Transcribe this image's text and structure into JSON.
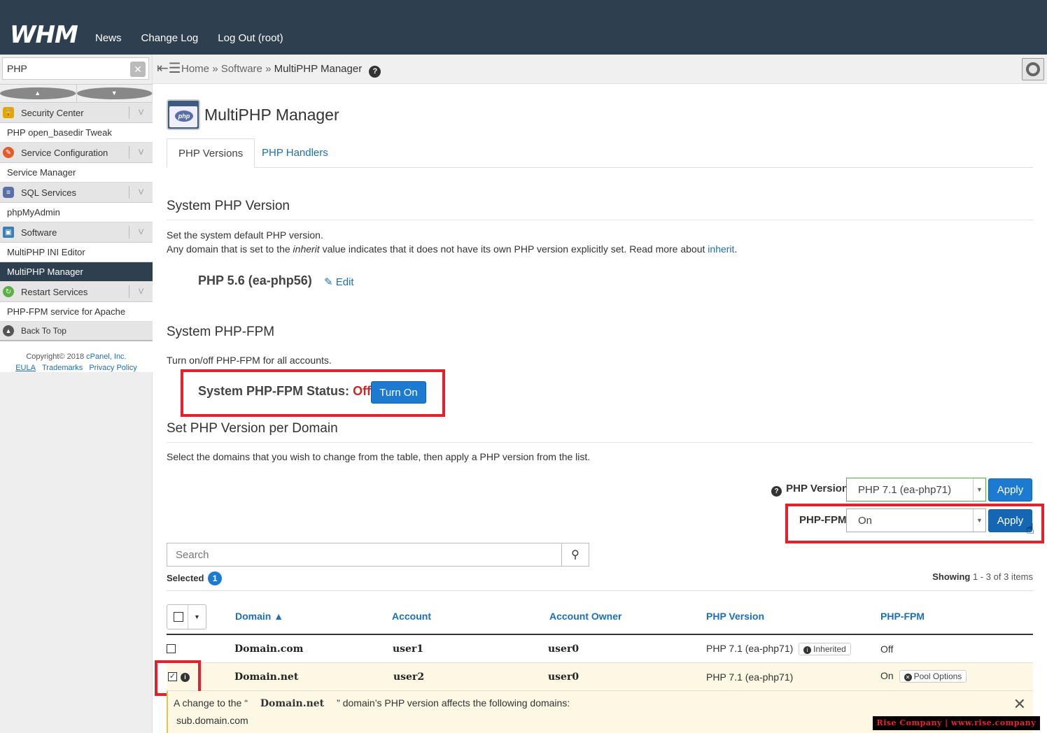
{
  "header": {
    "logo": "WHM",
    "nav": [
      "News",
      "Change Log",
      "Log Out (root)"
    ]
  },
  "sidebar": {
    "search_value": "PHP",
    "items": [
      {
        "type": "category",
        "label": "Security Center",
        "icon": "lock-icon",
        "color": "#e6a400"
      },
      {
        "type": "item",
        "label": "PHP open_basedir Tweak"
      },
      {
        "type": "category",
        "label": "Service Configuration",
        "icon": "wrench-icon",
        "color": "#e25c2a"
      },
      {
        "type": "item",
        "label": "Service Manager"
      },
      {
        "type": "category",
        "label": "SQL Services",
        "icon": "database-icon",
        "color": "#5a6fa8"
      },
      {
        "type": "item",
        "label": "phpMyAdmin"
      },
      {
        "type": "category",
        "label": "Software",
        "icon": "software-icon",
        "color": "#3b7fb5"
      },
      {
        "type": "item",
        "label": "MultiPHP INI Editor"
      },
      {
        "type": "item",
        "label": "MultiPHP Manager",
        "active": true
      },
      {
        "type": "category",
        "label": "Restart Services",
        "icon": "restart-icon",
        "color": "#5bb043"
      },
      {
        "type": "item",
        "label": "PHP-FPM service for Apache"
      }
    ],
    "back_to_top": "Back To Top",
    "copyright": "Copyright© 2018",
    "copyright_link": "cPanel, Inc.",
    "footer_links": [
      "EULA",
      "Trademarks",
      "Privacy Policy"
    ]
  },
  "breadcrumb": {
    "home": "Home",
    "section": "Software",
    "current": "MultiPHP Manager",
    "sep": "»"
  },
  "page": {
    "title": "MultiPHP Manager",
    "tabs": [
      "PHP Versions",
      "PHP Handlers"
    ],
    "system_php": {
      "heading": "System PHP Version",
      "line1": "Set the system default PHP version.",
      "line2_pre": "Any domain that is set to the",
      "line2_em": "inherit",
      "line2_post": "value indicates that it does not have its own PHP version explicitly set. Read more about",
      "line2_link": "inherit",
      "line2_end": ".",
      "current": "PHP 5.6 (ea-php56)",
      "edit": "Edit"
    },
    "fpm": {
      "heading": "System PHP-FPM",
      "desc": "Turn on/off PHP-FPM for all accounts.",
      "status_label": "System PHP-FPM Status:",
      "status_value": "Off",
      "button": "Turn On"
    },
    "per_domain": {
      "heading": "Set PHP Version per Domain",
      "desc": "Select the domains that you wish to change from the table, then apply a PHP version from the list.",
      "php_version_label": "PHP Version",
      "php_version_value": "PHP 7.1 (ea-php71)",
      "fpm_label": "PHP-FPM",
      "fpm_value": "On",
      "apply": "Apply",
      "search_placeholder": "Search",
      "selected_label": "Selected",
      "selected_count": "1",
      "showing_label": "Showing",
      "showing_value": "1 - 3 of 3 items"
    },
    "table": {
      "columns": [
        "Domain ▲",
        "Account",
        "Account Owner",
        "PHP Version",
        "PHP-FPM"
      ],
      "rows": [
        {
          "domain": "Domain.com",
          "account": "user1",
          "owner": "user0",
          "php": "PHP 7.1 (ea-php71)",
          "php_badge": "Inherited",
          "fpm": "Off",
          "fpm_badge": "",
          "checked": false
        },
        {
          "domain": "Domain.net",
          "account": "user2",
          "owner": "user0",
          "php": "PHP 7.1 (ea-php71)",
          "php_badge": "",
          "fpm": "On",
          "fpm_badge": "Pool Options",
          "checked": true
        }
      ]
    },
    "notice": {
      "pre": "A change to the “",
      "domain": "Domain.net",
      "post": "” domain’s PHP version affects the following domains:",
      "sub": "sub.domain.com"
    }
  },
  "watermark": "Rise Company | www.rise.company"
}
